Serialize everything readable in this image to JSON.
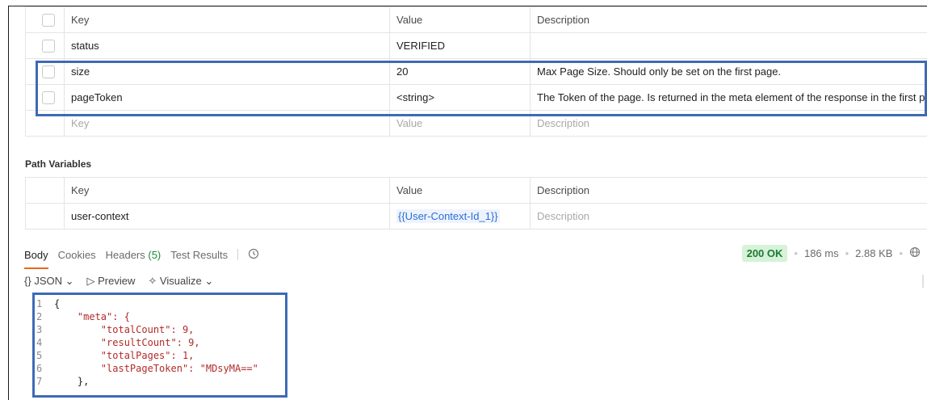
{
  "params": {
    "headers": {
      "key": "Key",
      "value": "Value",
      "description": "Description"
    },
    "rows": [
      {
        "key": "status",
        "value": "VERIFIED",
        "description": ""
      },
      {
        "key": "size",
        "value": "20",
        "description": "Max Page Size. Should only be set on the first page."
      },
      {
        "key": "pageToken",
        "value": "<string>",
        "description": "The Token of the page. Is returned in the meta element of the response in the first page."
      }
    ],
    "placeholder": {
      "key": "Key",
      "value": "Value",
      "description": "Description"
    }
  },
  "path_variables": {
    "title": "Path Variables",
    "headers": {
      "key": "Key",
      "value": "Value",
      "description": "Description"
    },
    "rows": [
      {
        "key": "user-context",
        "value": "{{User-Context-Id_1}}",
        "description": "Description"
      }
    ]
  },
  "response_tabs": {
    "body": "Body",
    "cookies": "Cookies",
    "headers": "Headers",
    "headers_count": "(5)",
    "test_results": "Test Results",
    "history_icon": "history-icon"
  },
  "status": {
    "code": "200 OK",
    "time": "186 ms",
    "size": "2.88 KB",
    "globe_icon": "globe-icon"
  },
  "toolbar": {
    "format": "JSON",
    "preview": "Preview",
    "visualize": "Visualize"
  },
  "code_lines": [
    {
      "n": "1",
      "text": "{"
    },
    {
      "n": "2",
      "text": "    \"meta\": {"
    },
    {
      "n": "3",
      "text": "        \"totalCount\": 9,"
    },
    {
      "n": "4",
      "text": "        \"resultCount\": 9,"
    },
    {
      "n": "5",
      "text": "        \"totalPages\": 1,"
    },
    {
      "n": "6",
      "text": "        \"lastPageToken\": \"MDsyMA==\""
    },
    {
      "n": "7",
      "text": "    },"
    }
  ],
  "colors": {
    "highlight": "#3d6bb5",
    "accent": "#e56a1f",
    "ok_bg": "#d6f2d8",
    "ok_text": "#1c7a34"
  }
}
